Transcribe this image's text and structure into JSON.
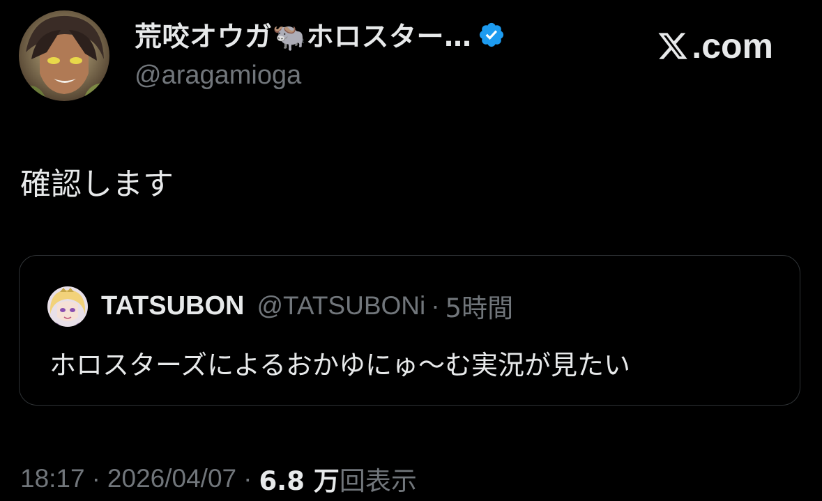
{
  "author": {
    "display_name": "荒咬オウガ🐃ホロスター…",
    "handle": "@aragamioga",
    "verified": true,
    "avatar_icon": "avatar-icon"
  },
  "brand": {
    "text": ".com",
    "logo_icon": "x-logo-icon"
  },
  "tweet": {
    "text": "確認します"
  },
  "quote": {
    "name": "TATSUBON",
    "handle": "@TATSUBONi",
    "separator": "·",
    "time": "5時間",
    "text": "ホロスターズによるおかゆにゅ〜む実況が見たい"
  },
  "meta": {
    "time": "18:17",
    "separator": "·",
    "date": "2026/04/07",
    "views_count": "6.8 万",
    "views_label": "回表示"
  },
  "colors": {
    "background": "#000000",
    "primary_text": "#e7e9ea",
    "secondary_text": "#71767b",
    "verified_blue": "#1d9bf0",
    "border": "#2f3336"
  }
}
